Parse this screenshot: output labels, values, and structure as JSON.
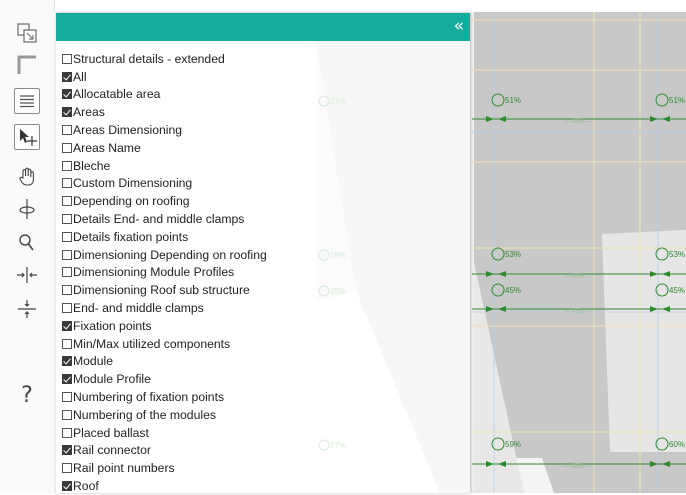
{
  "toolbar": {
    "tools": [
      {
        "icon": "select-area-icon"
      },
      {
        "icon": "corner-icon"
      },
      {
        "icon": "layers-icon",
        "selected": true
      },
      {
        "icon": "pointer-move-icon",
        "selected": true
      },
      {
        "icon": "hand-pan-icon"
      },
      {
        "icon": "rotate-axis-icon"
      },
      {
        "icon": "search-icon"
      },
      {
        "icon": "horizontal-distribute-icon"
      },
      {
        "icon": "vertical-distribute-icon"
      },
      {
        "icon": "help-icon",
        "label": "?"
      }
    ]
  },
  "panel": {
    "header_color": "#17aa9e",
    "collapse_label": "«",
    "layers": [
      {
        "label": "Structural details - extended",
        "checked": false
      },
      {
        "label": "All",
        "checked": true
      },
      {
        "label": "Allocatable area",
        "checked": true
      },
      {
        "label": "Areas",
        "checked": true
      },
      {
        "label": "Areas Dimensioning",
        "checked": false
      },
      {
        "label": "Areas Name",
        "checked": false
      },
      {
        "label": "Bleche",
        "checked": false
      },
      {
        "label": "Custom Dimensioning",
        "checked": false
      },
      {
        "label": "Depending on roofing",
        "checked": false
      },
      {
        "label": "Details End- and middle clamps",
        "checked": false
      },
      {
        "label": "Details fixation points",
        "checked": false
      },
      {
        "label": "Dimensioning Depending on roofing",
        "checked": false
      },
      {
        "label": "Dimensioning Module Profiles",
        "checked": false
      },
      {
        "label": "Dimensioning Roof sub structure",
        "checked": false
      },
      {
        "label": "End- and middle clamps",
        "checked": false
      },
      {
        "label": "Fixation points",
        "checked": true
      },
      {
        "label": "Min/Max utilized components",
        "checked": false
      },
      {
        "label": "Module",
        "checked": true
      },
      {
        "label": "Module Profile",
        "checked": true
      },
      {
        "label": "Numbering of fixation points",
        "checked": false
      },
      {
        "label": "Numbering of the modules",
        "checked": false
      },
      {
        "label": "Placed ballast",
        "checked": false
      },
      {
        "label": "Rail connector",
        "checked": true
      },
      {
        "label": "Rail point numbers",
        "checked": false
      },
      {
        "label": "Roof",
        "checked": true
      }
    ]
  },
  "drawing": {
    "markers": [
      {
        "label": "51%"
      },
      {
        "label": "51%"
      },
      {
        "label": "53%"
      },
      {
        "label": "53%"
      },
      {
        "label": "45%"
      },
      {
        "label": "45%"
      },
      {
        "label": "59%"
      },
      {
        "label": "60%"
      }
    ],
    "faint_markers": [
      {
        "label": "27%"
      },
      {
        "label": "28%"
      },
      {
        "label": "25%"
      },
      {
        "label": "27%"
      }
    ],
    "roof_color": "#c8c8c8",
    "marker_color": "#2e8b2e"
  }
}
